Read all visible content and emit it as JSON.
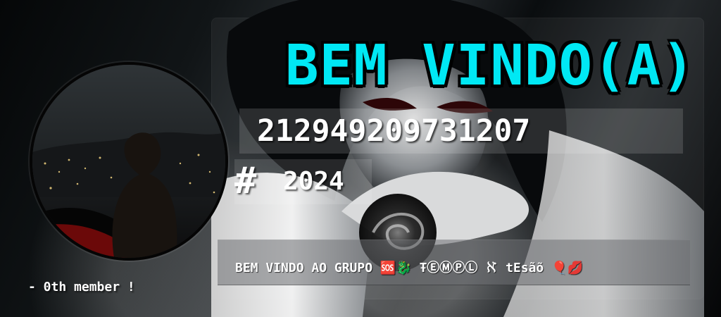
{
  "card": {
    "title": "BEM VINDO(A)",
    "member_id": "212949209731207",
    "hash_symbol": "#",
    "year": "2024",
    "welcome_message": "BEM VINDO AO GRUPO 🆘🐉 ŦⒺⓂⓅⓁ ℵ tEsãõ 🎈💋",
    "member_count": "- 0th member !",
    "colors": {
      "title": "#00e8f4",
      "text": "#ffffff",
      "outline": "#000000"
    }
  },
  "images": {
    "avatar": "circular-avatar-photo",
    "background": "anime-character-background"
  }
}
